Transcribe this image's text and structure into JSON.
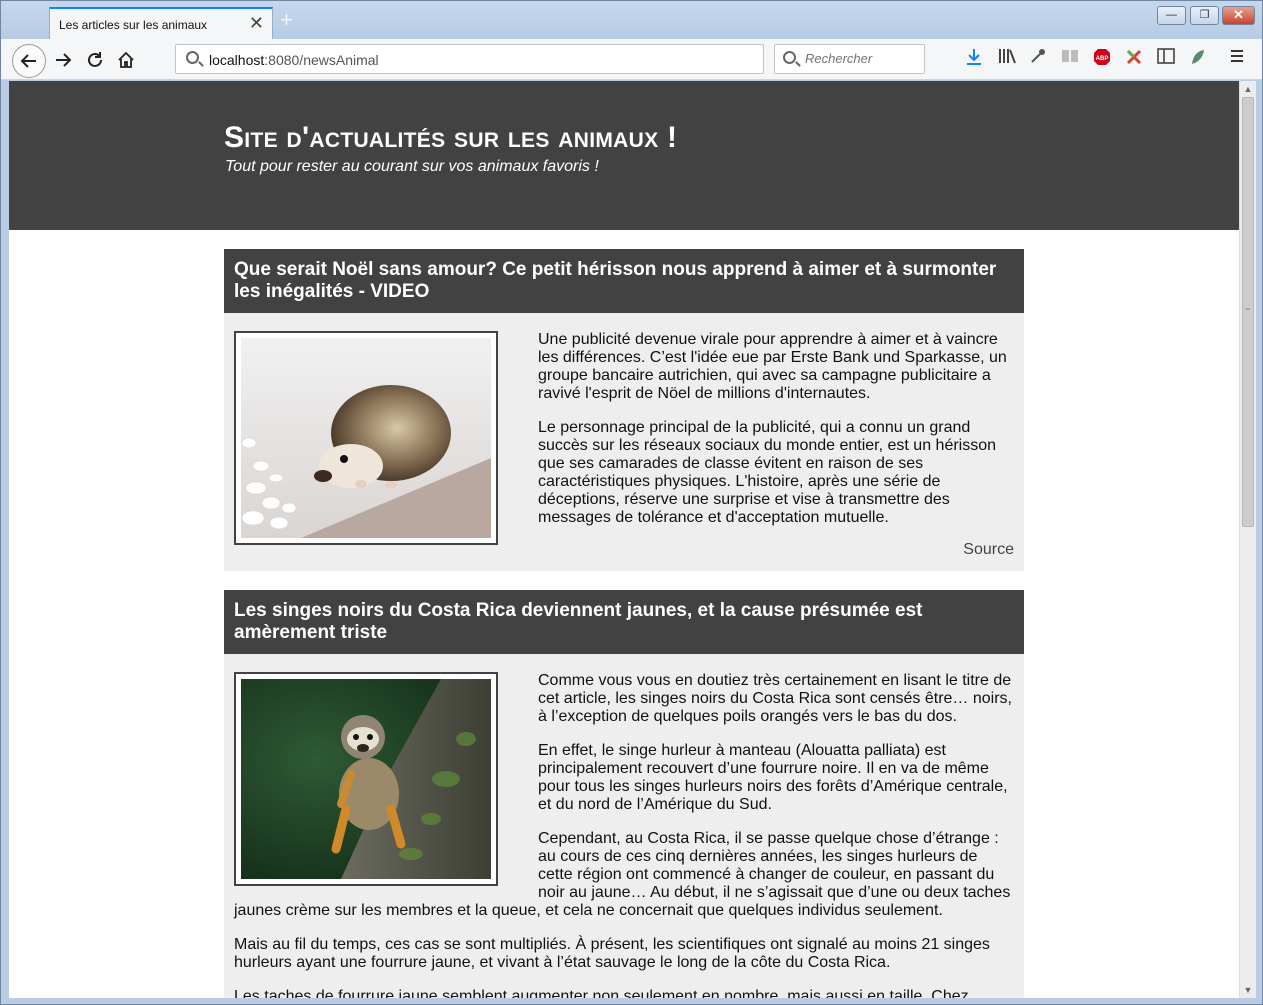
{
  "browser": {
    "tab_title": "Les articles sur les animaux",
    "tab_close": "✕",
    "new_tab": "+",
    "url_host": "localhost",
    "url_rest": ":8080/newsAnimal",
    "search_placeholder": "Rechercher",
    "window_controls": {
      "minimize": "—",
      "maximize": "❐",
      "close": "✕"
    }
  },
  "site": {
    "title": "Site d'actualités sur les animaux !",
    "subtitle": "Tout pour rester au courant sur vos animaux favoris !"
  },
  "articles": [
    {
      "title": "Que serait Noël sans amour? Ce petit hérisson nous apprend à aimer et à surmonter les inégalités - VIDEO",
      "image": "hedgehog-photo",
      "paragraphs": [
        "Une publicité devenue virale pour apprendre à aimer et à vaincre les différences. C’est l'idée eue par Erste Bank und Sparkasse, un groupe bancaire autrichien, qui avec sa campagne publicitaire a ravivé l'esprit de Nöel de millions d'internautes.",
        "Le personnage principal de la publicité, qui a connu un grand succès sur les réseaux sociaux du monde entier, est un hérisson que ses camarades de classe évitent en raison de ses caractéristiques physiques. L'histoire, après une série de déceptions, réserve une surprise et vise à transmettre des messages de tolérance et d'acceptation mutuelle."
      ],
      "source_label": "Source"
    },
    {
      "title": "Les singes noirs du Costa Rica deviennent jaunes, et la cause présumée est amèrement triste",
      "image": "squirrel-monkey-photo",
      "paragraphs": [
        "Comme vous vous en doutiez très certainement en lisant le titre de cet article, les singes noirs du Costa Rica sont censés être… noirs, à l’exception de quelques poils orangés vers le bas du dos.",
        "En effet, le singe hurleur à manteau (Alouatta palliata) est principalement recouvert d’une fourrure noire. Il en va de même pour tous les singes hurleurs noirs des forêts d’Amérique centrale, et du nord de l’Amérique du Sud.",
        "Cependant, au Costa Rica, il se passe quelque chose d’étrange : au cours de ces cinq dernières années, les singes hurleurs de cette région ont commencé à changer de couleur, en passant du noir au jaune… Au début, il ne s’agissait que d’une ou deux taches jaunes crème sur les membres et la queue, et cela ne concernait que quelques individus seulement.",
        "Mais au fil du temps, ces cas se sont multipliés. À présent, les scientifiques ont signalé au moins 21 singes hurleurs ayant une fourrure jaune, et vivant à l’état sauvage le long de la côte du Costa Rica.",
        "Les taches de fourrure jaune semblent augmenter non seulement en nombre, mais aussi en taille. Chez"
      ]
    }
  ]
}
